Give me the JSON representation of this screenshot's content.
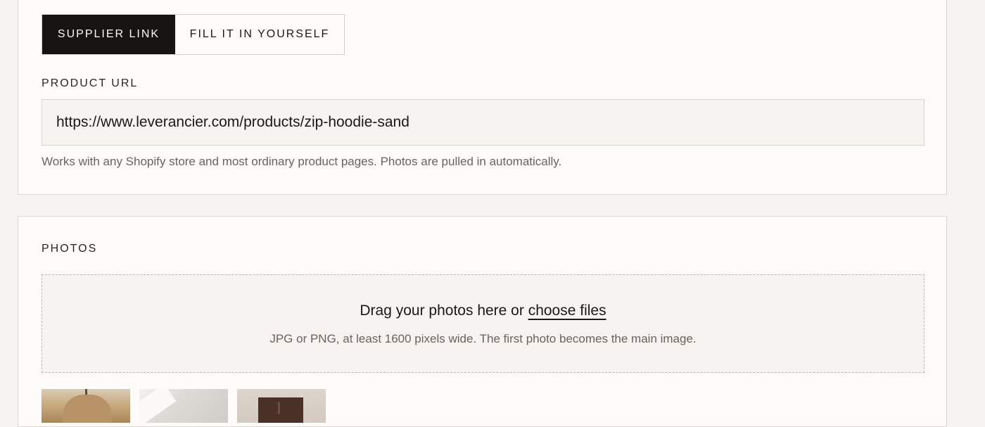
{
  "source_section": {
    "tabs": [
      {
        "label": "SUPPLIER LINK",
        "active": true
      },
      {
        "label": "FILL IT IN YOURSELF",
        "active": false
      }
    ],
    "product_url_label": "PRODUCT URL",
    "product_url_value": "https://www.leverancier.com/products/zip-hoodie-sand",
    "help_text": "Works with any Shopify store and most ordinary product pages. Photos are pulled in automatically."
  },
  "photos_section": {
    "label": "PHOTOS",
    "dropzone": {
      "prefix": "Drag your photos here or ",
      "link": "choose files",
      "hint": "JPG or PNG, at least 1600 pixels wide. The first photo becomes the main image."
    },
    "thumbnails": [
      {
        "icon": "hoodie-photo"
      },
      {
        "icon": "fabric-photo"
      },
      {
        "icon": "pants-photo"
      }
    ]
  },
  "colors": {
    "page_background": "#f6f3f0",
    "card_background": "#fdfcfb",
    "active_tab_background": "#171312",
    "border": "#dcd6d1",
    "muted_text": "#6b625d"
  }
}
